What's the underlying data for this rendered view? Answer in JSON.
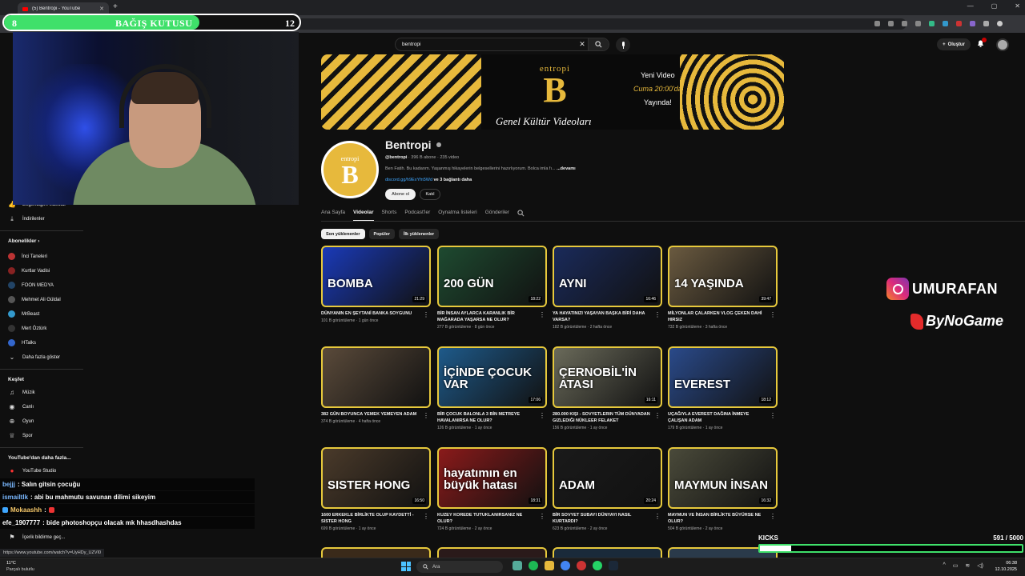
{
  "browser": {
    "tab_title": "(5) Bentropi - YouTube",
    "new_tab": "+",
    "status_url": "https://www.youtube.com/watch?v=UyHDy_UZVI0"
  },
  "donation": {
    "left": "8",
    "label": "BAĞIŞ KUTUSU",
    "right": "12",
    "progress": 0.66
  },
  "youtube": {
    "search_value": "bentropi",
    "create_label": "Oluştur"
  },
  "banner": {
    "logo_word": "entropi",
    "logo_letter": "B",
    "tagline": "Genel Kültür Videoları",
    "new_line1": "Yeni Video",
    "new_line2": "Cuma 20:00'da",
    "new_line3": "Yayında!"
  },
  "channel": {
    "avatar_word": "entropi",
    "avatar_letter": "B",
    "name": "Bentropi",
    "handle": "@bentropi",
    "stats": "· 396 B abone · 235 video",
    "description": "Ben Fatih. Bu kadarım. Yaşanmış hikayelerin belgesellerini hazırlıyorum. Bolca imla fı...",
    "more": "...devamı",
    "link_url": "discord.gg/h9ExYfn5Wd",
    "link_more": "ve 3 bağlantı daha",
    "subscribe": "Abone ol",
    "join": "Katıl"
  },
  "tabs": [
    "Ana Sayfa",
    "Videolar",
    "Shorts",
    "Podcast'ler",
    "Oynatma listeleri",
    "Gönderiler"
  ],
  "chips": [
    "Son yüklenenler",
    "Popüler",
    "İlk yüklenenler"
  ],
  "sidebar": {
    "items_top": [
      {
        "label": "Beğendiğim videolar",
        "icon": "thumbs-up-icon"
      },
      {
        "label": "İndirilenler",
        "icon": "download-icon"
      }
    ],
    "subs_header": "Abonelikler",
    "subs": [
      {
        "label": "İnci Taneleri",
        "color": "#b33"
      },
      {
        "label": "Kurtlar Vadisi",
        "color": "#822"
      },
      {
        "label": "FOON MEDYA",
        "color": "#246"
      },
      {
        "label": "Mehmet Ali Güldal",
        "color": "#555"
      },
      {
        "label": "MrBeast",
        "color": "#39c"
      },
      {
        "label": "Mert Öztürk",
        "color": "#333"
      },
      {
        "label": "HTalks",
        "color": "#36c"
      }
    ],
    "show_more": "Daha fazla göster",
    "explore_header": "Keşfet",
    "explore": [
      {
        "label": "Müzik",
        "icon": "music-icon"
      },
      {
        "label": "Canlı",
        "icon": "live-icon"
      },
      {
        "label": "Oyun",
        "icon": "gamepad-icon"
      },
      {
        "label": "Spor",
        "icon": "trophy-icon"
      }
    ],
    "more_header": "YouTube'dan daha fazla...",
    "studio": "YouTube Studio",
    "report": "İçerik bildirme geç..."
  },
  "videos": [
    {
      "thumb_text": "BOMBA",
      "duration": "21:29",
      "title": "DÜNYANIN EN ŞEYTANİ BANKA SOYGUNU",
      "meta": "101 B görüntüleme · 1 gün önce",
      "bg": "#1a3ab8",
      "accent": "#d22"
    },
    {
      "thumb_text": "200 GÜN",
      "duration": "18:22",
      "title": "BİR İNSAN AYLARCA KARANLIK BİR MAĞARADA YAŞARSA NE OLUR?",
      "meta": "277 B görüntüleme · 8 gün önce",
      "bg": "#1e4a30",
      "accent": "#e7c93c"
    },
    {
      "thumb_text": "AYNI",
      "duration": "16:46",
      "title": "YA HAYATINIZI YAŞAYAN BAŞKA BİRİ DAHA VARSA?",
      "meta": "182 B görüntüleme · 2 hafta önce",
      "bg": "#1a2a5a",
      "accent": "#e7c93c"
    },
    {
      "thumb_text": "14 YAŞINDA",
      "duration": "39:47",
      "title": "MİLYONLAR ÇALARKEN VLOG ÇEKEN DAHİ HIRSIZ",
      "meta": "732 B görüntüleme · 3 hafta önce",
      "bg": "#6a5a40",
      "accent": "#d22"
    },
    {
      "thumb_text": "",
      "duration": "",
      "title": "382 GÜN BOYUNCA YEMEK YEMEYEN ADAM",
      "meta": "374 B görüntüleme · 4 hafta önce",
      "bg": "#5a4a3a",
      "accent": "#aaa"
    },
    {
      "thumb_text": "İÇİNDE ÇOCUK VAR",
      "duration": "17:06",
      "title": "BİR ÇOCUK BALONLA 3 BİN METREYE HAVALANIRSA NE OLUR?",
      "meta": "126 B görüntüleme · 1 ay önce",
      "bg": "#1e5a8a",
      "accent": "#e7c93c"
    },
    {
      "thumb_text": "ÇERNOBİL'İN ATASI",
      "duration": "16:11",
      "title": "280.000 Kişi - Sovyetlerin Tüm Dünyadan Gizlediği Nükleer Felaket",
      "meta": "156 B görüntüleme · 1 ay önce",
      "bg": "#6a6a5a",
      "accent": "#e7c93c"
    },
    {
      "thumb_text": "EVEREST",
      "duration": "18:12",
      "title": "UÇAĞIYLA EVEREST DAĞINA İNMEYE ÇALIŞAN ADAM",
      "meta": "179 B görüntüleme · 1 ay önce",
      "bg": "#2a4a8a",
      "accent": "#e7c93c"
    },
    {
      "thumb_text": "SISTER HONG",
      "duration": "16:50",
      "title": "1600 ERKEKLE BİRLİKTE OLUP KAYDETTİ - Sister Hong",
      "meta": "699 B görüntüleme · 1 ay önce",
      "bg": "#4a3a2a",
      "accent": "#e7c93c"
    },
    {
      "thumb_text": "hayatımın en büyük hatası",
      "duration": "18:31",
      "title": "KUZEY KOREDE TUTUKLANIRSANIZ NE OLUR?",
      "meta": "724 B görüntüleme · 2 ay önce",
      "bg": "#8a1a1a",
      "accent": "#e7c93c"
    },
    {
      "thumb_text": "ADAM",
      "duration": "20:24",
      "title": "BİR SOVYET SUBAYI DÜNYAYI NASIL KURTARDI?",
      "meta": "623 B görüntüleme · 2 ay önce",
      "bg": "#1a1a1a",
      "accent": "#e7c93c"
    },
    {
      "thumb_text": "MAYMUN İNSAN",
      "duration": "16:32",
      "title": "MAYMUN VE İNSAN BİRLİKTE BÜYÜRSE NE OLUR?",
      "meta": "504 B görüntüleme · 2 ay önce",
      "bg": "#4a4a3a",
      "accent": "#e7c93c"
    }
  ],
  "overlays": {
    "instagram": "UMURAFAN",
    "bynogame": "ByNoGame",
    "kicks_label": "KICKS",
    "kicks_count": "591 / 5000",
    "kicks_progress": 0.118
  },
  "chat": [
    {
      "user": "bejjj",
      "text": ": Salın gitsin çocuğu"
    },
    {
      "user": "ismailtlk",
      "text": ": abi bu mahmutu savunan dilimi sikeyim"
    },
    {
      "user": "Mokaashh",
      "text": ":"
    },
    {
      "user": "efe_1907777",
      "text": ": bide photoshopçu olacak mk hhasdhashdas"
    }
  ],
  "taskbar": {
    "temp": "11°C",
    "weather": "Parçalı bulutlu",
    "search": "Ara",
    "time": "06:38",
    "date": "12.10.2025"
  }
}
